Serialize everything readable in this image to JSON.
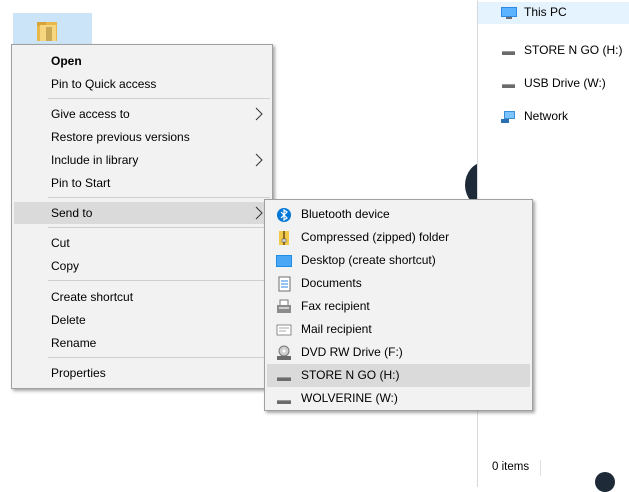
{
  "explorer": {
    "nav": [
      {
        "label": "This PC",
        "icon": "computer-icon"
      },
      {
        "label": "STORE N GO (H:)",
        "icon": "drive-icon"
      },
      {
        "label": "USB Drive (W:)",
        "icon": "drive-icon"
      },
      {
        "label": "Network",
        "icon": "network-icon"
      }
    ],
    "status": "0 items"
  },
  "context_menu": {
    "open": "Open",
    "pin_quick": "Pin to Quick access",
    "give_access": "Give access to",
    "restore": "Restore previous versions",
    "include_library": "Include in library",
    "pin_start": "Pin to Start",
    "send_to": "Send to",
    "cut": "Cut",
    "copy": "Copy",
    "create_shortcut": "Create shortcut",
    "delete": "Delete",
    "rename": "Rename",
    "properties": "Properties"
  },
  "send_to_menu": [
    {
      "label": "Bluetooth device",
      "icon": "bluetooth-icon"
    },
    {
      "label": "Compressed (zipped) folder",
      "icon": "zip-folder-icon"
    },
    {
      "label": "Desktop (create shortcut)",
      "icon": "desktop-icon"
    },
    {
      "label": "Documents",
      "icon": "documents-icon"
    },
    {
      "label": "Fax recipient",
      "icon": "fax-icon"
    },
    {
      "label": "Mail recipient",
      "icon": "mail-icon"
    },
    {
      "label": "DVD RW Drive (F:)",
      "icon": "dvd-drive-icon"
    },
    {
      "label": "STORE N GO (H:)",
      "icon": "drive-icon"
    },
    {
      "label": "WOLVERINE (W:)",
      "icon": "drive-icon"
    }
  ],
  "colors": {
    "menu_bg": "#f2f2f2",
    "hover_bg": "#dadada",
    "selection_bg": "#cce4f7",
    "accent": "#0078d7"
  }
}
